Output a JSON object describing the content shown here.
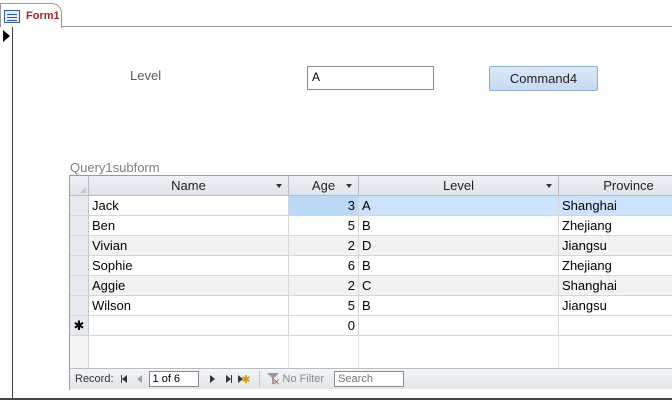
{
  "form": {
    "tab_title": "Form1",
    "level_label": "Level",
    "level_value": "A",
    "command_label": "Command4",
    "subform_label": "Query1subform"
  },
  "datasheet": {
    "columns": [
      "Name",
      "Age",
      "Level",
      "Province"
    ],
    "rows": [
      {
        "name": "Jack",
        "age": "3",
        "level": "A",
        "province": "Shanghai"
      },
      {
        "name": "Ben",
        "age": "5",
        "level": "B",
        "province": "Zhejiang"
      },
      {
        "name": "Vivian",
        "age": "2",
        "level": "D",
        "province": "Jiangsu"
      },
      {
        "name": "Sophie",
        "age": "6",
        "level": "B",
        "province": "Zhejiang"
      },
      {
        "name": "Aggie",
        "age": "2",
        "level": "C",
        "province": "Shanghai"
      },
      {
        "name": "Wilson",
        "age": "5",
        "level": "B",
        "province": "Jiangsu"
      }
    ],
    "new_row": {
      "marker": "✱",
      "age": "0"
    }
  },
  "navigation": {
    "record_label": "Record:",
    "position": "1 of 6",
    "filter_label": "No Filter",
    "search_placeholder": "Search"
  },
  "icons": {
    "tab": "form-icon",
    "selector": "current-record-arrow-icon",
    "filter": "no-filter-icon"
  }
}
